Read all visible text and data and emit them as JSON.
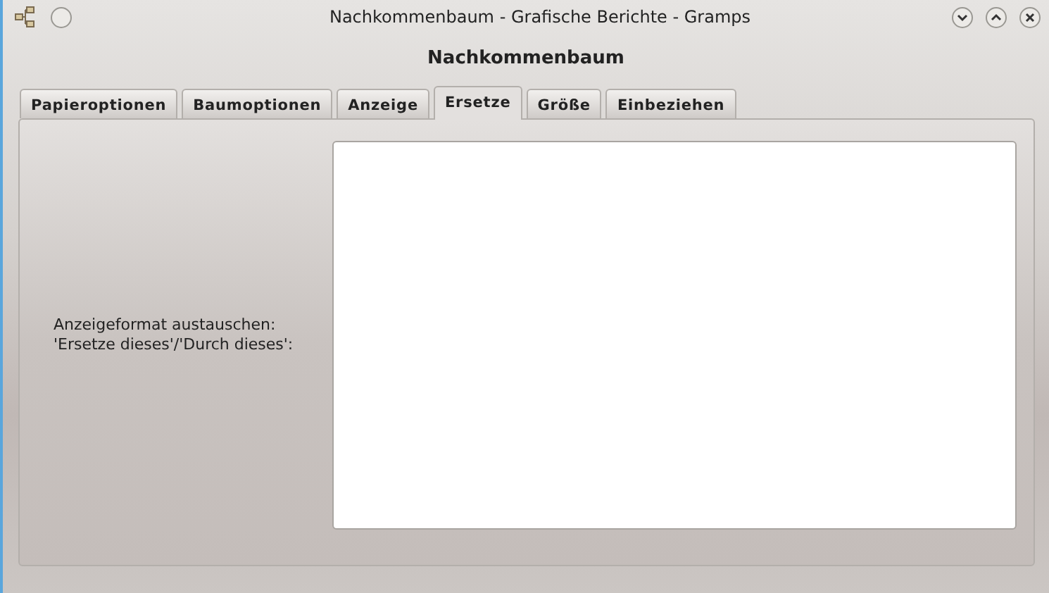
{
  "window": {
    "title": "Nachkommenbaum - Grafische Berichte - Gramps"
  },
  "heading": "Nachkommenbaum",
  "tabs": [
    {
      "label": "Papieroptionen",
      "selected": false
    },
    {
      "label": "Baumoptionen",
      "selected": false
    },
    {
      "label": "Anzeige",
      "selected": false
    },
    {
      "label": "Ersetze",
      "selected": true
    },
    {
      "label": "Größe",
      "selected": false
    },
    {
      "label": "Einbeziehen",
      "selected": false
    }
  ],
  "field": {
    "label_lines": [
      "Anzeigeformat austauschen:",
      "'Ersetze dieses'/'Durch dieses':"
    ]
  }
}
